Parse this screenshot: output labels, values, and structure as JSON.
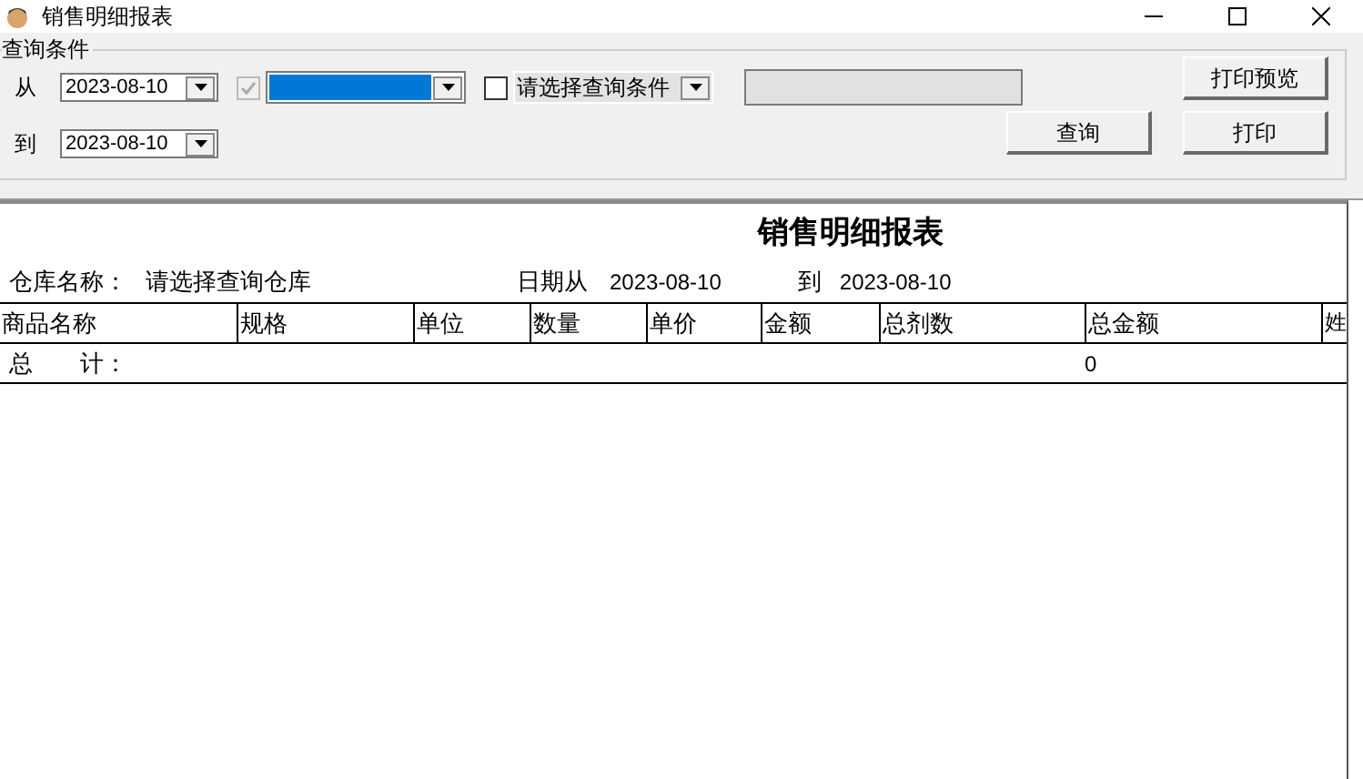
{
  "window": {
    "title": "销售明细报表"
  },
  "query_group": {
    "title": "查询条件",
    "from_label": "从",
    "from_date": "2023-08-10",
    "to_label": "到",
    "to_date": "2023-08-10",
    "filter_checkbox_1": {
      "checked": true,
      "disabled": true
    },
    "filter_combo_1": {
      "highlighted": true
    },
    "filter_checkbox_2": {
      "checked": false,
      "disabled": false
    },
    "condition_combo": {
      "value": "请选择查询条件"
    },
    "buttons": [
      {
        "kind": "preview",
        "label": "打印预览"
      },
      {
        "kind": "query",
        "label": "查询"
      },
      {
        "kind": "print",
        "label": "打印"
      }
    ]
  },
  "report": {
    "title": "销售明细报表",
    "warehouse_label": "仓库名称：",
    "warehouse_value": "请选择查询仓库",
    "date_from_label": "日期从",
    "date_from": "2023-08-10",
    "date_to_label": "到",
    "date_to": "2023-08-10",
    "columns": [
      "商品名称",
      "规格",
      "单位",
      "数量",
      "单价",
      "金额",
      "总剂数",
      "总金额",
      "姓"
    ],
    "total_row": {
      "label": "总　　计：",
      "total_amount": "0"
    }
  }
}
